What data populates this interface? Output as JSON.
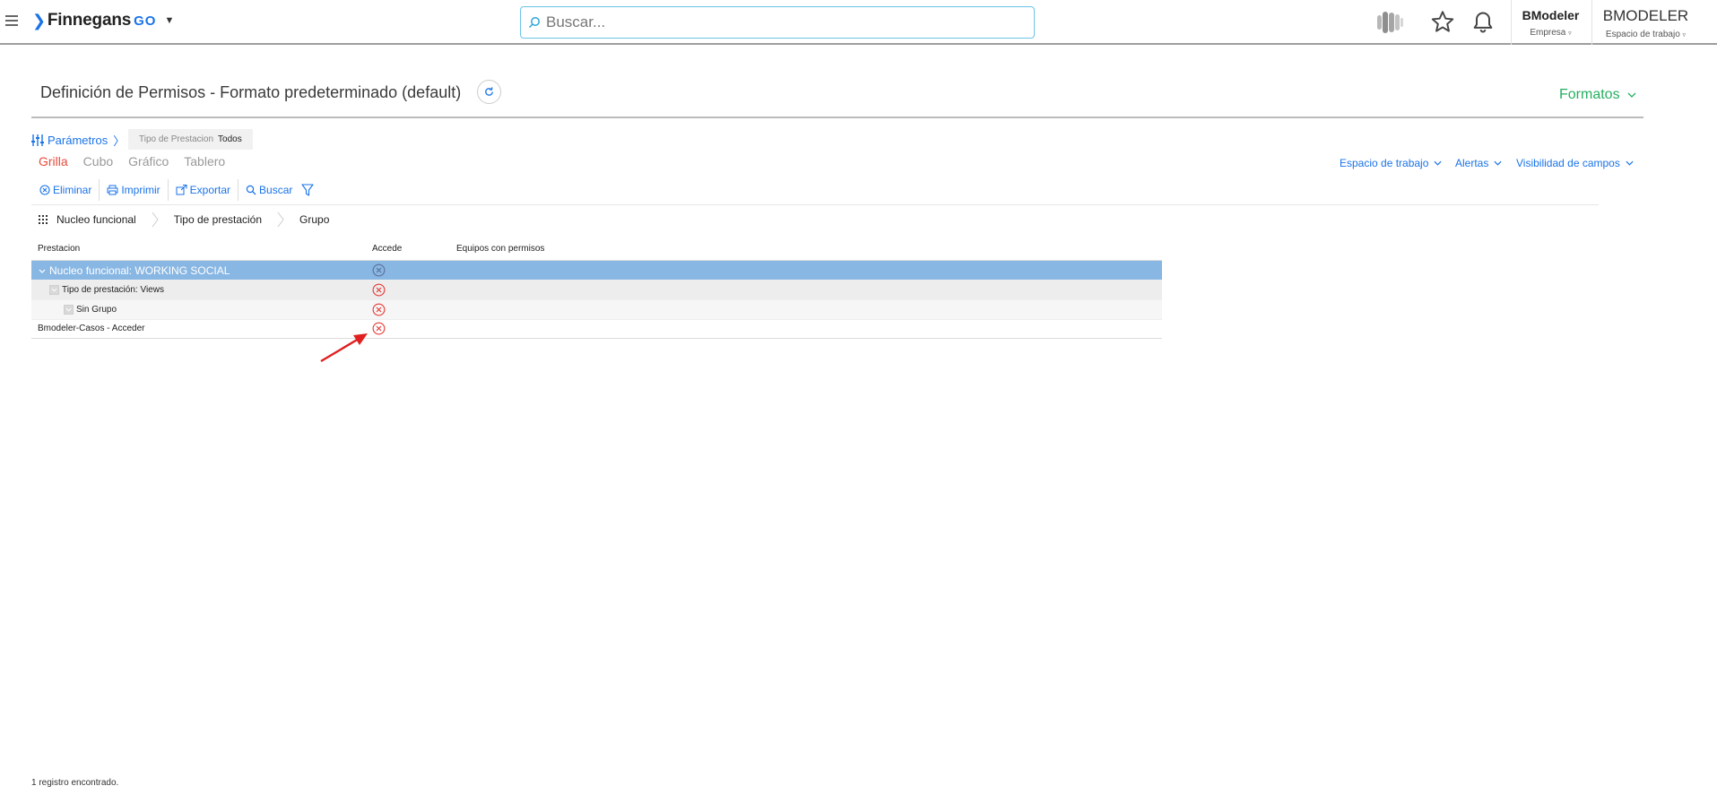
{
  "app": {
    "brand_name": "Finnegans",
    "brand_suffix": "GO",
    "search_placeholder": "Buscar...",
    "company_name": "BModeler",
    "company_label": "Empresa",
    "workspace_name": "BMODELER",
    "workspace_label": "Espacio de trabajo"
  },
  "page": {
    "title": "Definición de Permisos - Formato predeterminado (default)",
    "formats_label": "Formatos"
  },
  "params": {
    "label": "Parámetros",
    "separator": "〉",
    "chip_key": "Tipo de Prestacion",
    "chip_value": "Todos"
  },
  "tabs": [
    {
      "label": "Grilla",
      "active": true
    },
    {
      "label": "Cubo",
      "active": false
    },
    {
      "label": "Gráfico",
      "active": false
    },
    {
      "label": "Tablero",
      "active": false
    }
  ],
  "right_links": {
    "workspace": "Espacio de trabajo",
    "alerts": "Alertas",
    "field_visibility": "Visibilidad de campos"
  },
  "toolbar": {
    "delete": "Eliminar",
    "print": "Imprimir",
    "export": "Exportar",
    "search": "Buscar"
  },
  "grouping": [
    "Nucleo funcional",
    "Tipo de prestación",
    "Grupo"
  ],
  "grid": {
    "columns": [
      "Prestacion",
      "Accede",
      "Equipos con permisos"
    ],
    "rows": [
      {
        "label": "Nucleo funcional: WORKING SOCIAL",
        "level": 0,
        "accede": "no"
      },
      {
        "label": "Tipo de prestación: Views",
        "level": 1,
        "accede": "no"
      },
      {
        "label": "Sin Grupo",
        "level": 2,
        "accede": "no"
      },
      {
        "label": "Bmodeler-Casos - Acceder",
        "level": 3,
        "accede": "no"
      }
    ]
  },
  "footer": {
    "count_text": "1 registro encontrado."
  },
  "colors": {
    "accent_blue": "#1a73e8",
    "active_tab_red": "#e74c3c",
    "formats_green": "#27ae60",
    "selected_row": "#89b7e3",
    "deny_red": "#e53935"
  }
}
